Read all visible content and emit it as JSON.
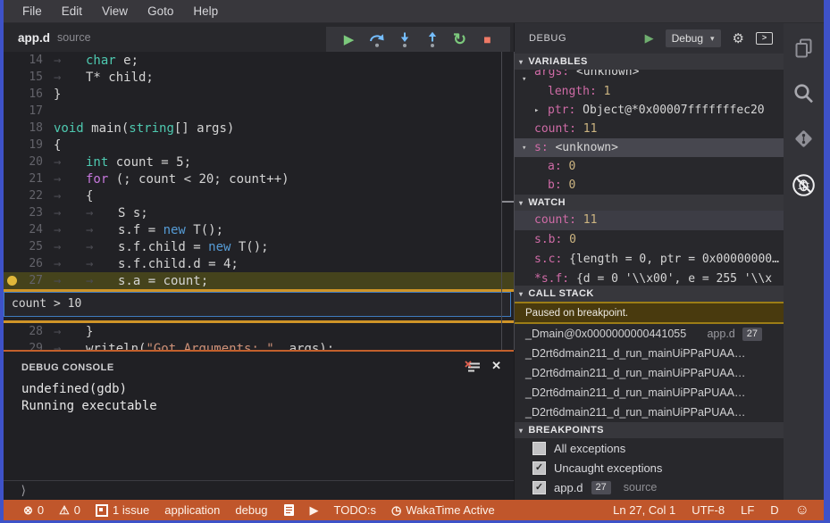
{
  "menu": {
    "items": [
      "File",
      "Edit",
      "View",
      "Goto",
      "Help"
    ]
  },
  "tab": {
    "name": "app.d",
    "hint": "source"
  },
  "debug_toolbar": {
    "buttons": [
      {
        "name": "continue",
        "glyph": "play"
      },
      {
        "name": "step-over",
        "glyph": "over"
      },
      {
        "name": "step-into",
        "glyph": "into"
      },
      {
        "name": "step-out",
        "glyph": "out"
      },
      {
        "name": "restart",
        "glyph": "restart"
      },
      {
        "name": "stop",
        "glyph": "stop"
      }
    ]
  },
  "editor": {
    "breakpoint_line": 27,
    "current_line": 27,
    "condition_value": "count > 10",
    "lines": [
      {
        "num": 14,
        "indent": 1,
        "tokens": [
          [
            "k",
            "char"
          ],
          [
            "p",
            " e;"
          ]
        ]
      },
      {
        "num": 15,
        "indent": 1,
        "tokens": [
          [
            "p",
            "T* child;"
          ]
        ]
      },
      {
        "num": 16,
        "indent": 0,
        "tokens": [
          [
            "p",
            "}"
          ]
        ]
      },
      {
        "num": 17,
        "indent": 0,
        "tokens": []
      },
      {
        "num": 18,
        "indent": 0,
        "tokens": [
          [
            "k",
            "void"
          ],
          [
            "p",
            " main("
          ],
          [
            "k",
            "string"
          ],
          [
            "p",
            "[] args)"
          ]
        ]
      },
      {
        "num": 19,
        "indent": 0,
        "tokens": [
          [
            "p",
            "{"
          ]
        ]
      },
      {
        "num": 20,
        "indent": 1,
        "tokens": [
          [
            "k",
            "int"
          ],
          [
            "p",
            " count = 5;"
          ]
        ]
      },
      {
        "num": 21,
        "indent": 1,
        "tokens": [
          [
            "c",
            "for"
          ],
          [
            "p",
            " (; count < 20; count++)"
          ]
        ]
      },
      {
        "num": 22,
        "indent": 1,
        "tokens": [
          [
            "p",
            "{"
          ]
        ]
      },
      {
        "num": 23,
        "indent": 2,
        "tokens": [
          [
            "p",
            "S s;"
          ]
        ]
      },
      {
        "num": 24,
        "indent": 2,
        "tokens": [
          [
            "p",
            "s.f = "
          ],
          [
            "n",
            "new"
          ],
          [
            "p",
            " T();"
          ]
        ]
      },
      {
        "num": 25,
        "indent": 2,
        "tokens": [
          [
            "p",
            "s.f.child = "
          ],
          [
            "n",
            "new"
          ],
          [
            "p",
            " T();"
          ]
        ]
      },
      {
        "num": 26,
        "indent": 2,
        "tokens": [
          [
            "p",
            "s.f.child.d = 4;"
          ]
        ]
      },
      {
        "num": 27,
        "indent": 2,
        "tokens": [
          [
            "p",
            "s.a = count;"
          ]
        ]
      },
      {
        "num": 28,
        "indent": 1,
        "tokens": [
          [
            "p",
            "}"
          ]
        ]
      },
      {
        "num": 29,
        "indent": 1,
        "tokens": [
          [
            "p",
            "writeln("
          ],
          [
            "s",
            "\"Got Arguments: \""
          ],
          [
            "p",
            ", args);"
          ]
        ]
      }
    ]
  },
  "console": {
    "title": "DEBUG CONSOLE",
    "lines": [
      "undefined(gdb)",
      "Running executable"
    ],
    "prompt": "⟩"
  },
  "sidebar": {
    "title": "DEBUG",
    "profile_label": "Debug",
    "variables": {
      "header": "VARIABLES",
      "rows": [
        {
          "indent": 1,
          "expander": "▾",
          "name": "args",
          "value": "<unknown>",
          "vkind": "text",
          "clipped": true
        },
        {
          "indent": 2,
          "name": "length",
          "value": "1",
          "vkind": "num"
        },
        {
          "indent": 2,
          "expander": "▸",
          "name": "ptr",
          "value": "Object@*0x00007fffffffec20",
          "vkind": "text"
        },
        {
          "indent": 1,
          "name": "count",
          "value": "11",
          "vkind": "num"
        },
        {
          "indent": 1,
          "expander": "▾",
          "name": "s",
          "value": "<unknown>",
          "vkind": "text",
          "selected": true
        },
        {
          "indent": 2,
          "name": "a",
          "value": "0",
          "vkind": "num"
        },
        {
          "indent": 2,
          "name": "b",
          "value": "0",
          "vkind": "num"
        }
      ]
    },
    "watch": {
      "header": "WATCH",
      "rows": [
        {
          "name": "count",
          "value": "11",
          "vkind": "num",
          "selected": true
        },
        {
          "name": "s.b",
          "value": "0",
          "vkind": "num"
        },
        {
          "name": "s.c",
          "value": "{length = 0, ptr = 0x00000000…",
          "vkind": "text"
        },
        {
          "name": "*s.f",
          "value": "{d = 0 '\\\\x00', e = 255 '\\\\x",
          "vkind": "text"
        }
      ]
    },
    "call_stack": {
      "header": "CALL STACK",
      "status": "Paused on breakpoint.",
      "frames": [
        {
          "fn": "_Dmain@0x0000000000441055",
          "file": "app.d",
          "line": "27"
        },
        {
          "fn": "_D2rt6dmain211_d_run_mainUiPPaPUAA…"
        },
        {
          "fn": "_D2rt6dmain211_d_run_mainUiPPaPUAA…"
        },
        {
          "fn": "_D2rt6dmain211_d_run_mainUiPPaPUAA…"
        },
        {
          "fn": "_D2rt6dmain211_d_run_mainUiPPaPUAA…"
        }
      ]
    },
    "breakpoints": {
      "header": "BREAKPOINTS",
      "rows": [
        {
          "checked": false,
          "label": "All exceptions"
        },
        {
          "checked": true,
          "label": "Uncaught exceptions"
        },
        {
          "checked": true,
          "label": "app.d",
          "badge": "27",
          "hint": "source"
        }
      ]
    }
  },
  "activity_bar": {
    "icons": [
      {
        "name": "files"
      },
      {
        "name": "search"
      },
      {
        "name": "git"
      },
      {
        "name": "debug",
        "active": true
      }
    ]
  },
  "status_bar": {
    "left": [
      {
        "icon": "error",
        "text": "0"
      },
      {
        "icon": "warning",
        "text": "0"
      },
      {
        "icon": "issues",
        "text": "1 issue"
      },
      {
        "text": "application"
      },
      {
        "text": "debug"
      },
      {
        "icon": "file"
      },
      {
        "icon": "play"
      },
      {
        "text": "TODO:s"
      },
      {
        "icon": "clock",
        "text": "WakaTime Active"
      }
    ],
    "right": [
      {
        "text": "Ln 27, Col 1"
      },
      {
        "text": "UTF-8"
      },
      {
        "text": "LF"
      },
      {
        "text": "D"
      },
      {
        "icon": "smiley"
      }
    ]
  },
  "colors": {
    "window_edge": "#3e52c8",
    "status_bar": "#c0562b",
    "breakpoint_dot": "#e0b73a",
    "line_highlight": "#45431c",
    "condition_zone_border": "#cf9428",
    "paused_banner_border": "#9c7d16",
    "keyword": "#4ec9b0",
    "control_keyword": "#c678dd",
    "new_keyword": "#569cd6",
    "string": "#ce9178",
    "variable_name": "#cf6ba6",
    "variable_number": "#cdb581"
  }
}
